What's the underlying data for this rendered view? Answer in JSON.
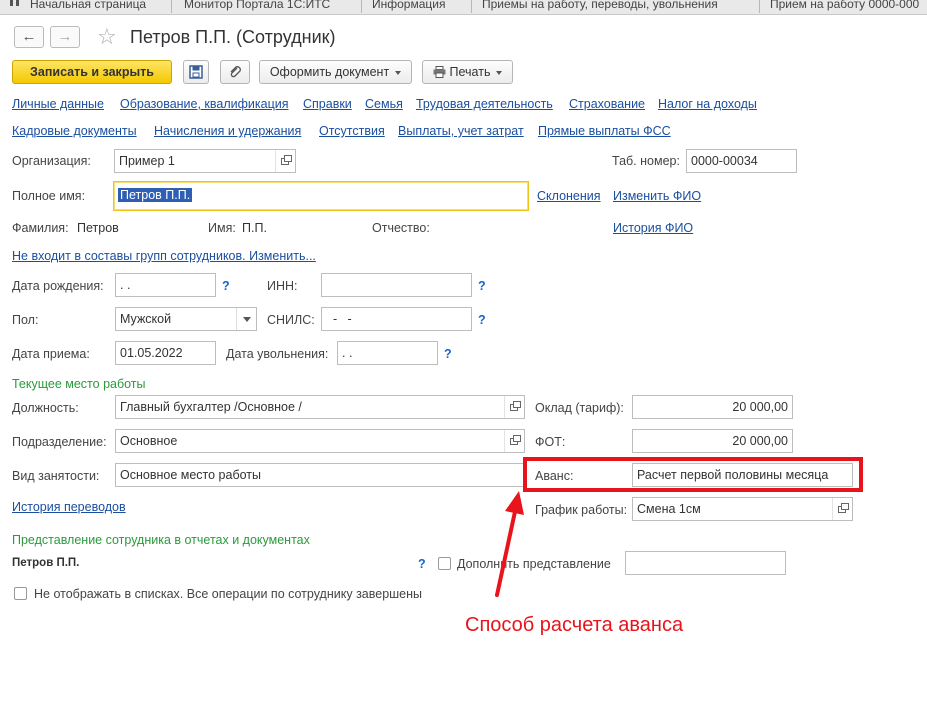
{
  "tabs": [
    {
      "label": "Начальная страница"
    },
    {
      "label": "Монитор Портала 1С:ИТС"
    },
    {
      "label": "Информация"
    },
    {
      "label": "Приемы на работу, переводы, увольнения"
    },
    {
      "label": "Прием на работу 0000-000"
    }
  ],
  "header": {
    "title": "Петров П.П. (Сотрудник)",
    "back_icon": "arrow-left-icon",
    "forward_icon": "arrow-right-icon",
    "favorite_icon": "star-icon"
  },
  "toolbar": {
    "save_close": "Записать и закрыть",
    "save_icon": "floppy-disk-icon",
    "attach_icon": "paperclip-icon",
    "make_document": "Оформить документ",
    "print": "Печать",
    "accent_color": "#f4c900"
  },
  "nav_links_row1": [
    "Личные данные",
    "Образование, квалификация",
    "Справки",
    "Семья",
    "Трудовая деятельность",
    "Страхование",
    "Налог на доходы"
  ],
  "nav_links_row2": [
    "Кадровые документы",
    "Начисления и удержания",
    "Отсутствия",
    "Выплаты, учет затрат",
    "Прямые выплаты ФСС"
  ],
  "form": {
    "org_label": "Организация:",
    "org_value": "Пример 1",
    "tab_no_label": "Таб. номер:",
    "tab_no_value": "0000-00034",
    "fullname_label": "Полное имя:",
    "fullname_value": "Петров П.П.",
    "declensions_link": "Склонения",
    "change_fio_link": "Изменить ФИО",
    "surname_label": "Фамилия:",
    "surname_value": "Петров",
    "name_label": "Имя:",
    "name_value": "П.П.",
    "patronymic_label": "Отчество:",
    "patronymic_value": "",
    "history_fio_link": "История ФИО",
    "groups_link": "Не входит в составы групп сотрудников. Изменить...",
    "birth_label": "Дата рождения:",
    "birth_value": " .  .",
    "inn_label": "ИНН:",
    "inn_value": "",
    "gender_label": "Пол:",
    "gender_value": "Мужской",
    "snils_label": "СНИЛС:",
    "snils_value": "  -   -",
    "hire_label": "Дата приема:",
    "hire_value": "01.05.2022",
    "fire_label": "Дата увольнения:",
    "fire_value": " .  .",
    "help_mark": "?",
    "current_work_header": "Текущее место работы",
    "position_label": "Должность:",
    "position_value": "Главный бухгалтер /Основное /",
    "salary_label": "Оклад (тариф):",
    "salary_value": "20 000,00",
    "dept_label": "Подразделение:",
    "dept_value": "Основное",
    "fot_label": "ФОТ:",
    "fot_value": "20 000,00",
    "employment_label": "Вид занятости:",
    "employment_value": "Основное место работы",
    "advance_label": "Аванс:",
    "advance_value": "Расчет первой половины месяца",
    "history_transfers_link": "История переводов",
    "schedule_label": "График работы:",
    "schedule_value": "Смена 1см",
    "repr_header": "Представление сотрудника в отчетах и документах",
    "repr_value": "Петров П.П.",
    "supplement_label": "Дополнить представление",
    "supplement_value": "",
    "hide_label": "Не отображать в списках. Все операции по сотруднику завершены"
  },
  "annotation": {
    "text": "Способ расчета аванса",
    "color": "#e8141c"
  }
}
